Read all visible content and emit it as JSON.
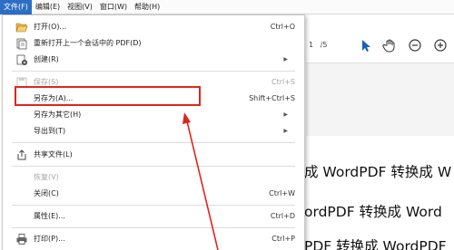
{
  "menubar": {
    "items": [
      "文件(F)",
      "编辑(E)",
      "视图(V)",
      "窗口(W)",
      "帮助(H)"
    ]
  },
  "doc": {
    "page_current": "1",
    "page_total": "/5",
    "lines": [
      "成 WordPDF 转换成 W",
      "ordPDF 转换成 Word",
      "PDF 转换成 WordPDF"
    ]
  },
  "menu": {
    "open": {
      "label": "打开(O)...",
      "shortcut": "Ctrl+O"
    },
    "reopen": {
      "label": "重新打开上一个会话中的 PDF(D)"
    },
    "create": {
      "label": "创建(R)"
    },
    "save": {
      "label": "保存(S)",
      "shortcut": "Ctrl+S"
    },
    "save_as": {
      "label": "另存为(A)...",
      "shortcut": "Shift+Ctrl+S"
    },
    "save_as_other": {
      "label": "另存为其它(H)"
    },
    "export_to": {
      "label": "导出到(T)"
    },
    "share": {
      "label": "共享文件(L)"
    },
    "revert": {
      "label": "恢复(V)"
    },
    "close": {
      "label": "关闭(C)",
      "shortcut": "Ctrl+W"
    },
    "properties": {
      "label": "属性(E)...",
      "shortcut": "Ctrl+D"
    },
    "print": {
      "label": "打印(P)...",
      "shortcut": "Ctrl+P"
    }
  },
  "colors": {
    "annotation": "#e1241c",
    "menubar_active": "#2d6ec4"
  }
}
